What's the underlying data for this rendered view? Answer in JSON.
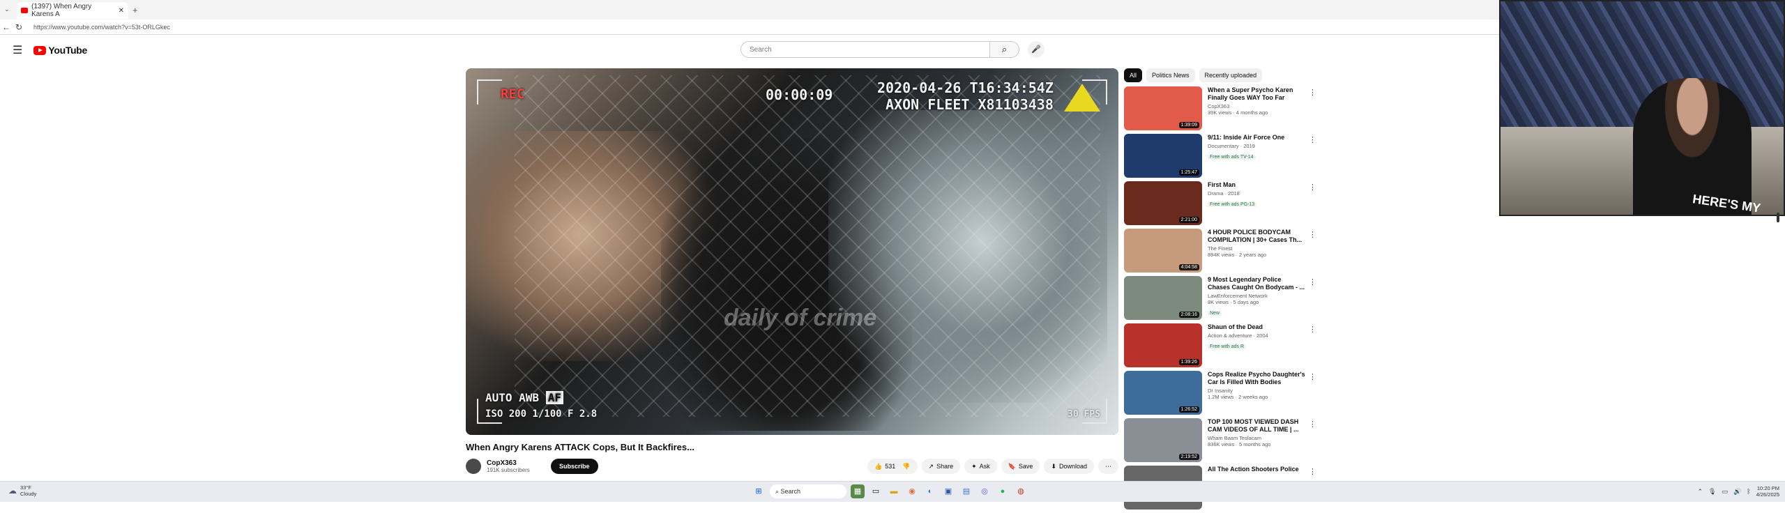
{
  "browser": {
    "tab_title": "(1397) When Angry Karens A",
    "url": "https://www.youtube.com/watch?v=53t-ORLGkec"
  },
  "youtube": {
    "logo_text": "YouTube",
    "search_placeholder": "Search"
  },
  "video": {
    "overlay": {
      "rec": "REC",
      "timecode": "00:00:09",
      "timestamp": "2020-04-26 T16:34:54Z",
      "device": "AXON FLEET X81103438",
      "awb": "AUTO AWB",
      "af": "AF",
      "iso": "ISO 200  1/100  F 2.8",
      "fps": "30 FPS",
      "watermark": "daily of crime"
    },
    "title": "When Angry Karens ATTACK Cops, But It Backfires...",
    "channel": "CopX363",
    "subscribers": "191K subscribers",
    "subscribe_label": "Subscribe",
    "like_count": "531",
    "share_label": "Share",
    "ask_label": "Ask",
    "save_label": "Save",
    "download_label": "Download"
  },
  "rail": {
    "chips": [
      "All",
      "Politics News",
      "Recently uploaded"
    ],
    "videos": [
      {
        "title": "When a Super Psycho Karen Finally Goes WAY Too Far",
        "channel": "CopX363",
        "views": "39K views · 4 months ago",
        "badge": "",
        "duration": "1:39:09",
        "thumb": "#e15a4a"
      },
      {
        "title": "9/11: Inside Air Force One",
        "channel": "Documentary · 2019",
        "views": "",
        "badge": "Free with ads  TV-14",
        "duration": "1:25:47",
        "thumb": "#1f3b6b"
      },
      {
        "title": "First Man",
        "channel": "Drama · 2018",
        "views": "",
        "badge": "Free with ads  PG-13",
        "duration": "2:21:00",
        "thumb": "#6b2a1e"
      },
      {
        "title": "4 HOUR POLICE BODYCAM COMPILATION | 30+ Cases Th...",
        "channel": "The Finest",
        "views": "894K views · 2 years ago",
        "badge": "",
        "duration": "4:04:58",
        "thumb": "#c69a7c"
      },
      {
        "title": "9 Most Legendary Police Chases Caught On Bodycam - ...",
        "channel": "LawEnforcement Network",
        "views": "8K views · 5 days ago",
        "badge": "New",
        "duration": "2:08:16",
        "thumb": "#7d8a7e"
      },
      {
        "title": "Shaun of the Dead",
        "channel": "Action & adventure · 2004",
        "views": "",
        "badge": "Free with ads  R",
        "duration": "1:39:26",
        "thumb": "#b8322b"
      },
      {
        "title": "Cops Realize Psycho Daughter's Car Is Filled With Bodies",
        "channel": "Dr Insanity",
        "views": "1.2M views · 2 weeks ago",
        "badge": "",
        "duration": "1:26:52",
        "thumb": "#3e6d9b"
      },
      {
        "title": "TOP 100 MOST VIEWED DASH CAM VIDEOS OF ALL TIME | ...",
        "channel": "Wham Baam Teslacam",
        "views": "836K views · 5 months ago",
        "badge": "",
        "duration": "2:19:52",
        "thumb": "#8a8f96"
      },
      {
        "title": "All The Action Shooters Police",
        "channel": "",
        "views": "",
        "badge": "",
        "duration": "",
        "thumb": "#666"
      }
    ]
  },
  "webcam": {
    "shirt_text": "HERE'S MY"
  },
  "taskbar": {
    "temp": "33°F",
    "condition": "Cloudy",
    "search": "Search",
    "time": "10:20 PM",
    "date": "4/26/2025"
  }
}
